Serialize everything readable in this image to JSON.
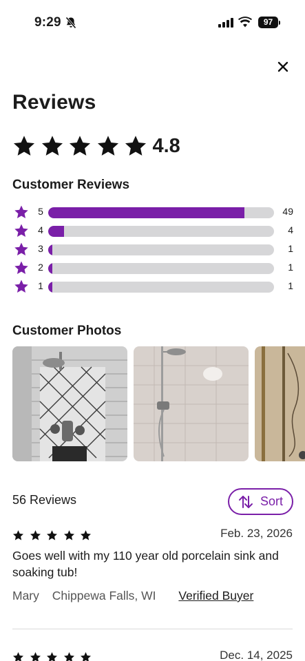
{
  "status_bar": {
    "time": "9:29",
    "battery": "97"
  },
  "page_title": "Reviews",
  "overall": {
    "rating_text": "4.8",
    "stars": 5
  },
  "customer_reviews": {
    "title": "Customer Reviews",
    "breakdown": [
      {
        "level": "5",
        "count": "49",
        "fraction": 0.87
      },
      {
        "level": "4",
        "count": "4",
        "fraction": 0.07
      },
      {
        "level": "3",
        "count": "1",
        "fraction": 0.018
      },
      {
        "level": "2",
        "count": "1",
        "fraction": 0.018
      },
      {
        "level": "1",
        "count": "1",
        "fraction": 0.018
      }
    ]
  },
  "customer_photos": {
    "title": "Customer Photos",
    "count_visible": 3
  },
  "reviews_header": {
    "count_label": "56 Reviews",
    "sort_label": "Sort"
  },
  "reviews": [
    {
      "stars": 5,
      "date": "Feb. 23, 2026",
      "text": "Goes well with my 110 year old porcelain sink and soaking tub!",
      "author": "Mary",
      "location": "Chippewa Falls, WI",
      "verified": "Verified Buyer"
    },
    {
      "stars": 5,
      "date": "Dec. 14, 2025"
    }
  ],
  "colors": {
    "accent": "#7a1fa8",
    "track": "#d6d6d8",
    "text": "#1c1c1c"
  },
  "icons": {
    "close": "close-icon",
    "sort": "sort-arrows-icon",
    "star": "star-icon"
  }
}
